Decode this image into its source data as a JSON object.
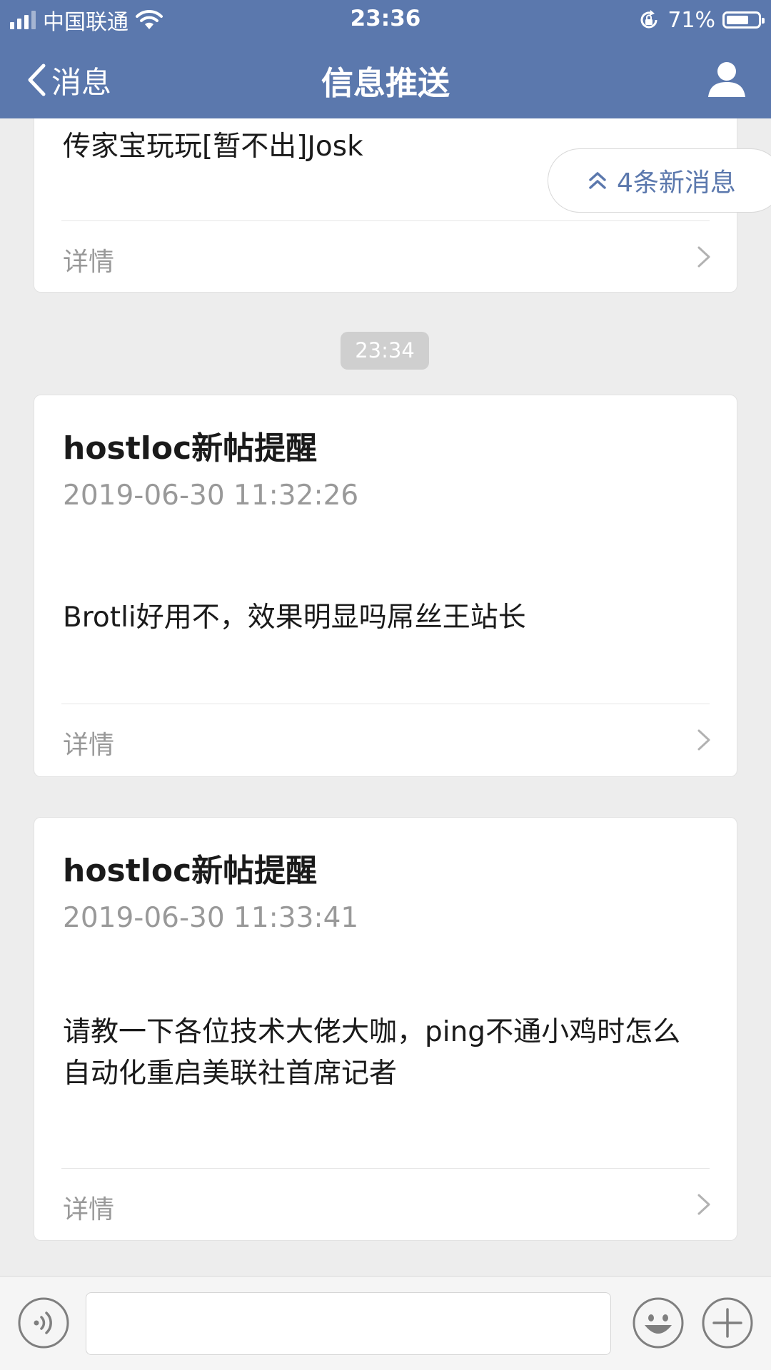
{
  "status_bar": {
    "carrier": "中国联通",
    "time": "23:36",
    "battery_percent": "71%",
    "battery_level": 0.71
  },
  "nav": {
    "back_label": "消息",
    "title": "信息推送"
  },
  "new_messages_label": "4条新消息",
  "timestamp_pill": "23:34",
  "cards": [
    {
      "title": "",
      "date": "",
      "body": "传家宝玩玩[暂不出]Josk",
      "footer": "详情"
    },
    {
      "title": "hostloc新帖提醒",
      "date": "2019-06-30 11:32:26",
      "body": "Brotli好用不，效果明显吗屌丝王站长",
      "footer": "详情"
    },
    {
      "title": "hostloc新帖提醒",
      "date": "2019-06-30 11:33:41",
      "body": "请教一下各位技术大佬大咖，ping不通小鸡时怎么自动化重启美联社首席记者",
      "footer": "详情"
    }
  ],
  "colors": {
    "header": "#5b78ad",
    "background": "#ededed",
    "accent": "#5b78ad"
  },
  "icons": [
    "signal-icon",
    "wifi-icon",
    "rotation-lock-icon",
    "battery-icon",
    "back-chevron-icon",
    "profile-icon",
    "double-chevron-up-icon",
    "chevron-right-icon",
    "voice-icon",
    "emoji-icon",
    "plus-icon"
  ]
}
